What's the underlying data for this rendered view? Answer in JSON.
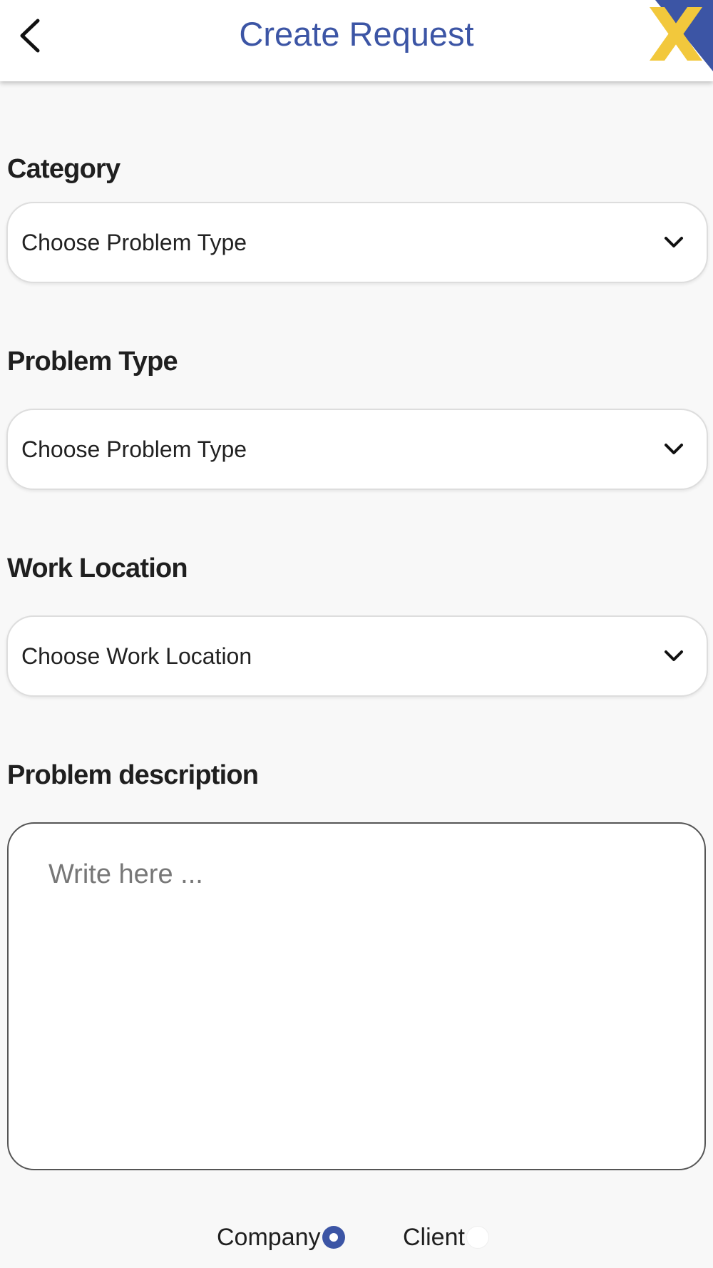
{
  "header": {
    "title": "Create Request",
    "back_icon": "chevron-left-icon",
    "logo_icon": "x-logo"
  },
  "colors": {
    "accent": "#3c55a5",
    "logo_yellow": "#f2c83c",
    "background": "#f8f8f8"
  },
  "form": {
    "category": {
      "label": "Category",
      "value": "Choose Problem Type"
    },
    "problem_type": {
      "label": "Problem Type",
      "value": "Choose Problem Type"
    },
    "work_location": {
      "label": "Work Location",
      "value": "Choose Work Location"
    },
    "description": {
      "label": "Problem description",
      "placeholder": "Write here ..."
    },
    "assignee": {
      "options": [
        {
          "label": "Company",
          "selected": true
        },
        {
          "label": "Client",
          "selected": false
        }
      ]
    }
  }
}
